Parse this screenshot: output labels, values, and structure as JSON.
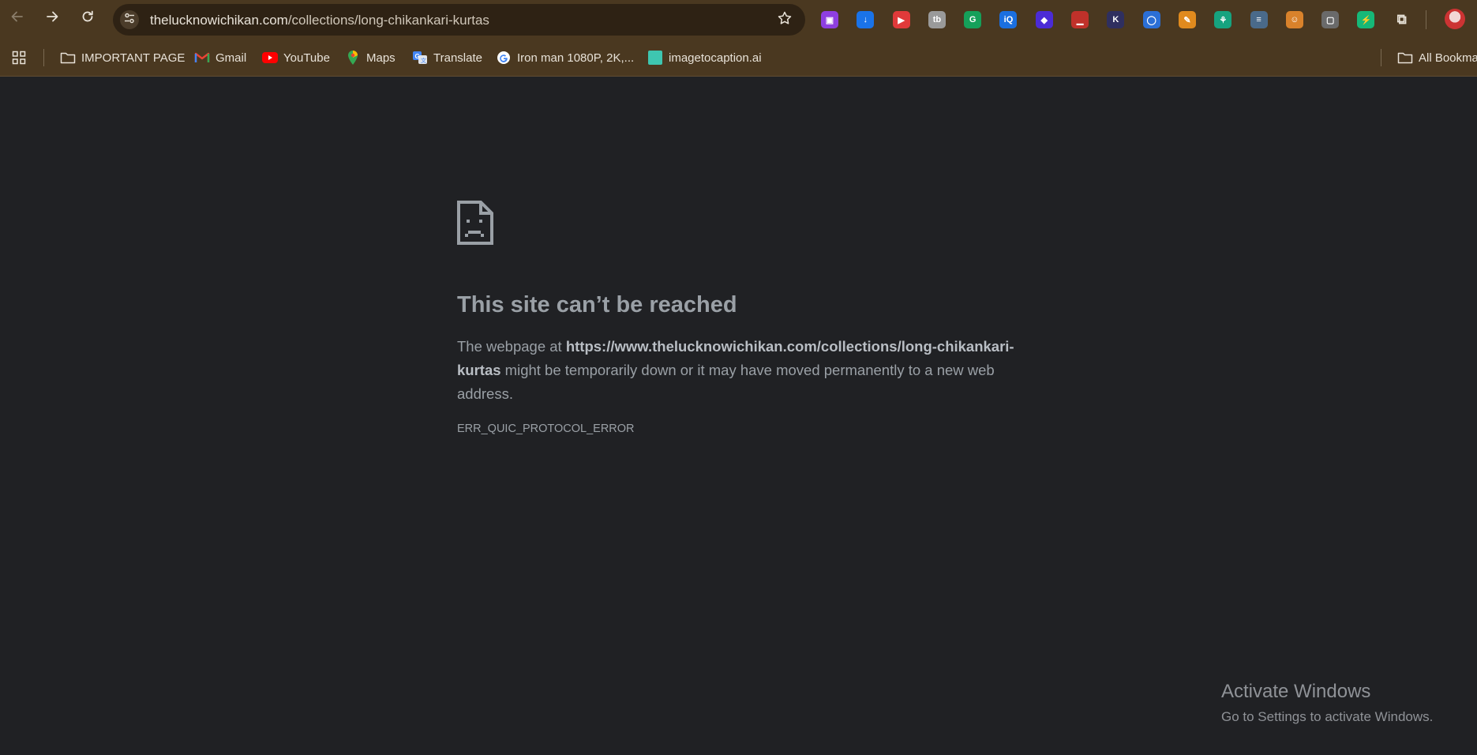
{
  "toolbar": {
    "back_icon": "arrow-left-icon",
    "forward_icon": "arrow-right-icon",
    "reload_icon": "reload-icon",
    "site_info_icon": "tune-icon",
    "url_host": "thelucknowichikan.com",
    "url_path": "/collections/long-chikankari-kurtas",
    "bookmark_star_icon": "star-icon"
  },
  "extensions": [
    {
      "name": "screen-recorder-extension-icon",
      "color": "#8e3fe0",
      "glyph": "▣"
    },
    {
      "name": "download-extension-icon",
      "color": "#1a73e8",
      "glyph": "↓"
    },
    {
      "name": "play-extension-icon",
      "color": "#e03a3a",
      "glyph": "▶"
    },
    {
      "name": "tb-extension-icon",
      "color": "#9a9a9a",
      "glyph": "tb"
    },
    {
      "name": "grammarly-extension-icon",
      "color": "#15a05a",
      "glyph": "G"
    },
    {
      "name": "iq-extension-icon",
      "color": "#1a6fe0",
      "glyph": "iQ"
    },
    {
      "name": "layers-extension-icon",
      "color": "#4b2bd6",
      "glyph": "◆"
    },
    {
      "name": "chart-extension-icon",
      "color": "#c0312a",
      "glyph": "▁"
    },
    {
      "name": "k-extension-icon",
      "color": "#2f2f5f",
      "glyph": "K"
    },
    {
      "name": "color-ring-extension-icon",
      "color": "#2b6fd6",
      "glyph": "◯"
    },
    {
      "name": "pencil-extension-icon",
      "color": "#e08a1e",
      "glyph": "✎"
    },
    {
      "name": "figure-extension-icon",
      "color": "#16a37f",
      "glyph": "⚘"
    },
    {
      "name": "text-extension-icon",
      "color": "#4a6a8a",
      "glyph": "≡"
    },
    {
      "name": "person-check-extension-icon",
      "color": "#d9822b",
      "glyph": "☺"
    },
    {
      "name": "robot-extension-icon",
      "color": "#6a6a6a",
      "glyph": "▢"
    },
    {
      "name": "lightning-extension-icon",
      "color": "#16b878",
      "glyph": "⚡"
    },
    {
      "name": "puzzle-extensions-icon",
      "color": "transparent",
      "glyph": "⧉"
    }
  ],
  "bookmarks": {
    "apps_icon": "apps-grid-icon",
    "items": [
      {
        "label": "IMPORTANT PAGE",
        "icon": "folder-icon"
      },
      {
        "label": "Gmail",
        "icon": "gmail-icon"
      },
      {
        "label": "YouTube",
        "icon": "youtube-icon"
      },
      {
        "label": "Maps",
        "icon": "maps-icon"
      },
      {
        "label": "Translate",
        "icon": "translate-icon"
      },
      {
        "label": "Iron man 1080P, 2K,...",
        "icon": "google-icon"
      },
      {
        "label": "imagetocaption.ai",
        "icon": "imagetocaption-icon"
      }
    ],
    "all_bookmarks_label": "All Bookmarks"
  },
  "error": {
    "icon": "sad-document-icon",
    "title": "This site can’t be reached",
    "desc_prefix": "The webpage at ",
    "desc_url": "https://www.thelucknowichikan.com/collections/long-chikankari-kurtas",
    "desc_suffix": " might be temporarily down or it may have moved permanently to a new web address.",
    "code": "ERR_QUIC_PROTOCOL_ERROR"
  },
  "watermark": {
    "title": "Activate Windows",
    "subtitle": "Go to Settings to activate Windows."
  }
}
